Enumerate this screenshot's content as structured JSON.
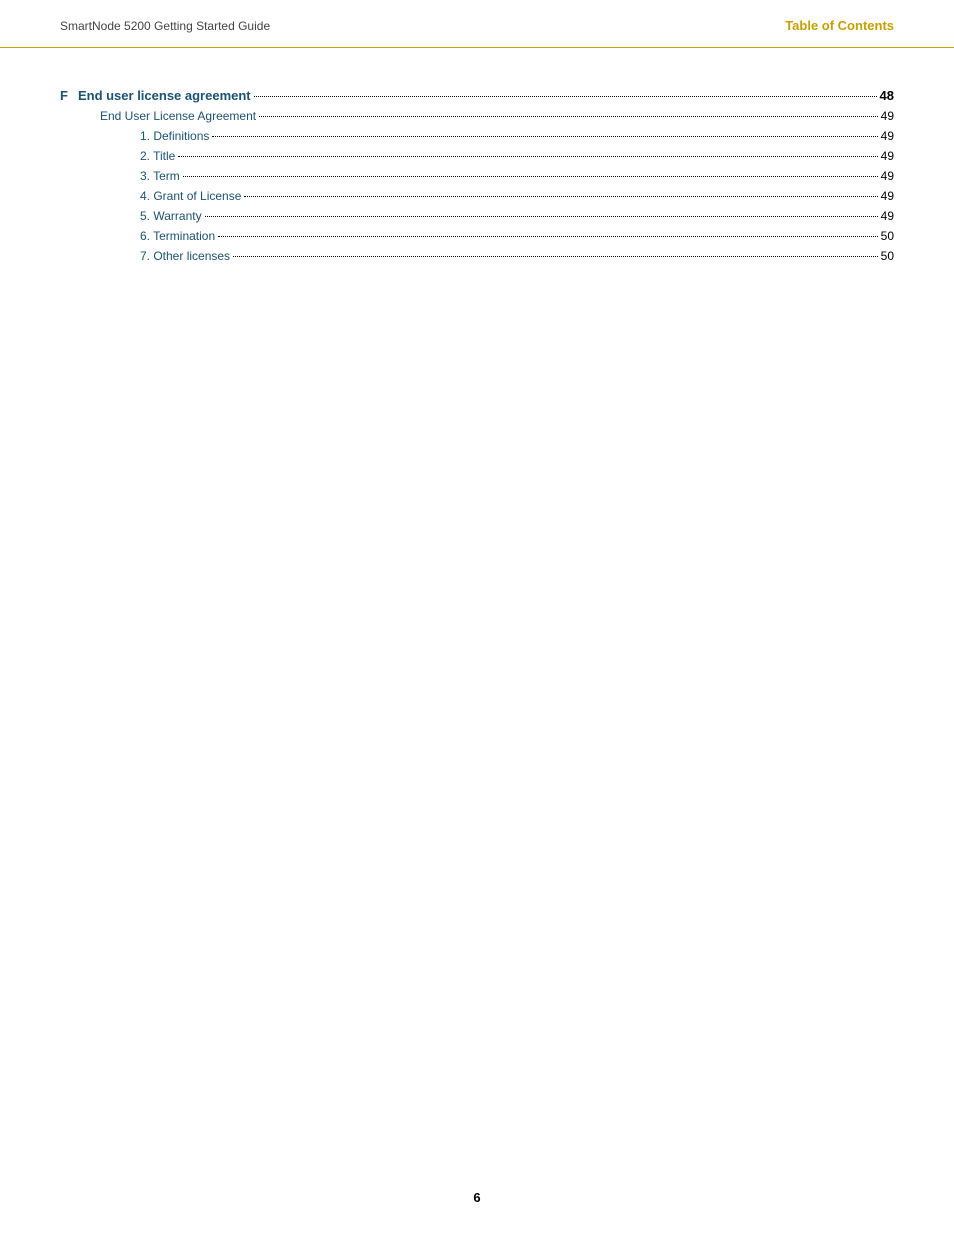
{
  "header": {
    "guide_title": "SmartNode 5200 Getting Started Guide",
    "toc_label": "Table of Contents"
  },
  "toc": {
    "entries": [
      {
        "level": "f",
        "prefix": "F",
        "label": "End user license agreement",
        "page": "48"
      },
      {
        "level": "2",
        "prefix": "",
        "label": "End User License Agreement",
        "page": "49"
      },
      {
        "level": "3",
        "prefix": "",
        "label": "1. Definitions",
        "page": "49"
      },
      {
        "level": "3",
        "prefix": "",
        "label": "2. Title",
        "page": "49"
      },
      {
        "level": "3",
        "prefix": "",
        "label": "3. Term",
        "page": "49"
      },
      {
        "level": "3",
        "prefix": "",
        "label": "4. Grant of License",
        "page": "49"
      },
      {
        "level": "3",
        "prefix": "",
        "label": "5. Warranty",
        "page": "49"
      },
      {
        "level": "3",
        "prefix": "",
        "label": "6. Termination",
        "page": "50"
      },
      {
        "level": "3",
        "prefix": "",
        "label": "7. Other licenses",
        "page": "50"
      }
    ]
  },
  "footer": {
    "page_number": "6"
  }
}
